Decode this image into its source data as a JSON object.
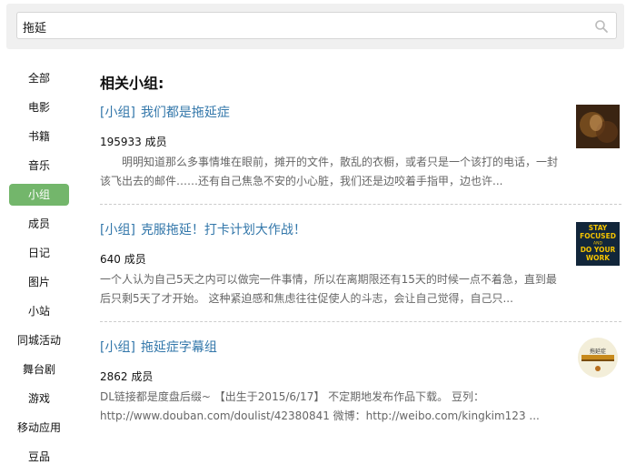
{
  "search": {
    "value": "拖延"
  },
  "sidebar": {
    "items": [
      {
        "label": "全部"
      },
      {
        "label": "电影"
      },
      {
        "label": "书籍"
      },
      {
        "label": "音乐"
      },
      {
        "label": "小组",
        "active": true
      },
      {
        "label": "成员"
      },
      {
        "label": "日记"
      },
      {
        "label": "图片"
      },
      {
        "label": "小站"
      },
      {
        "label": "同城活动"
      },
      {
        "label": "舞台剧"
      },
      {
        "label": "游戏"
      },
      {
        "label": "移动应用"
      },
      {
        "label": "豆品"
      }
    ]
  },
  "main": {
    "heading": "相关小组:",
    "groups": [
      {
        "tag": "[小组]",
        "name": "我们都是拖延症",
        "members": "195933 成员",
        "desc": "明明知道那么多事情堆在眼前，摊开的文件，散乱的衣橱，或者只是一个该打的电话，一封该飞出去的邮件……还有自己焦急不安的小心脏，我们还是边咬着手指甲，边也许..."
      },
      {
        "tag": "[小组]",
        "name": "克服拖延！打卡计划大作战！",
        "members": "640 成员",
        "desc": "一个人认为自己5天之内可以做完一件事情，所以在离期限还有15天的时候一点不着急，直到最后只剩5天了才开始。 这种紧迫感和焦虑往往促使人的斗志，会让自己觉得，自己只...",
        "thumb_text": [
          "STAY",
          "FOCUSED",
          "AND",
          "DO YOUR",
          "WORK"
        ]
      },
      {
        "tag": "[小组]",
        "name": "拖延症字幕组",
        "members": "2862 成员",
        "desc": "DL链接都是度盘后缀~ 【出生于2015/6/17】 不定期地发布作品下载。 豆列：http://www.douban.com/doulist/42380841 微博：http://weibo.com/kingkim123 ...",
        "thumb_text": "拖延症"
      }
    ]
  },
  "colors": {
    "accent": "#73b66b",
    "link": "#3377aa"
  }
}
